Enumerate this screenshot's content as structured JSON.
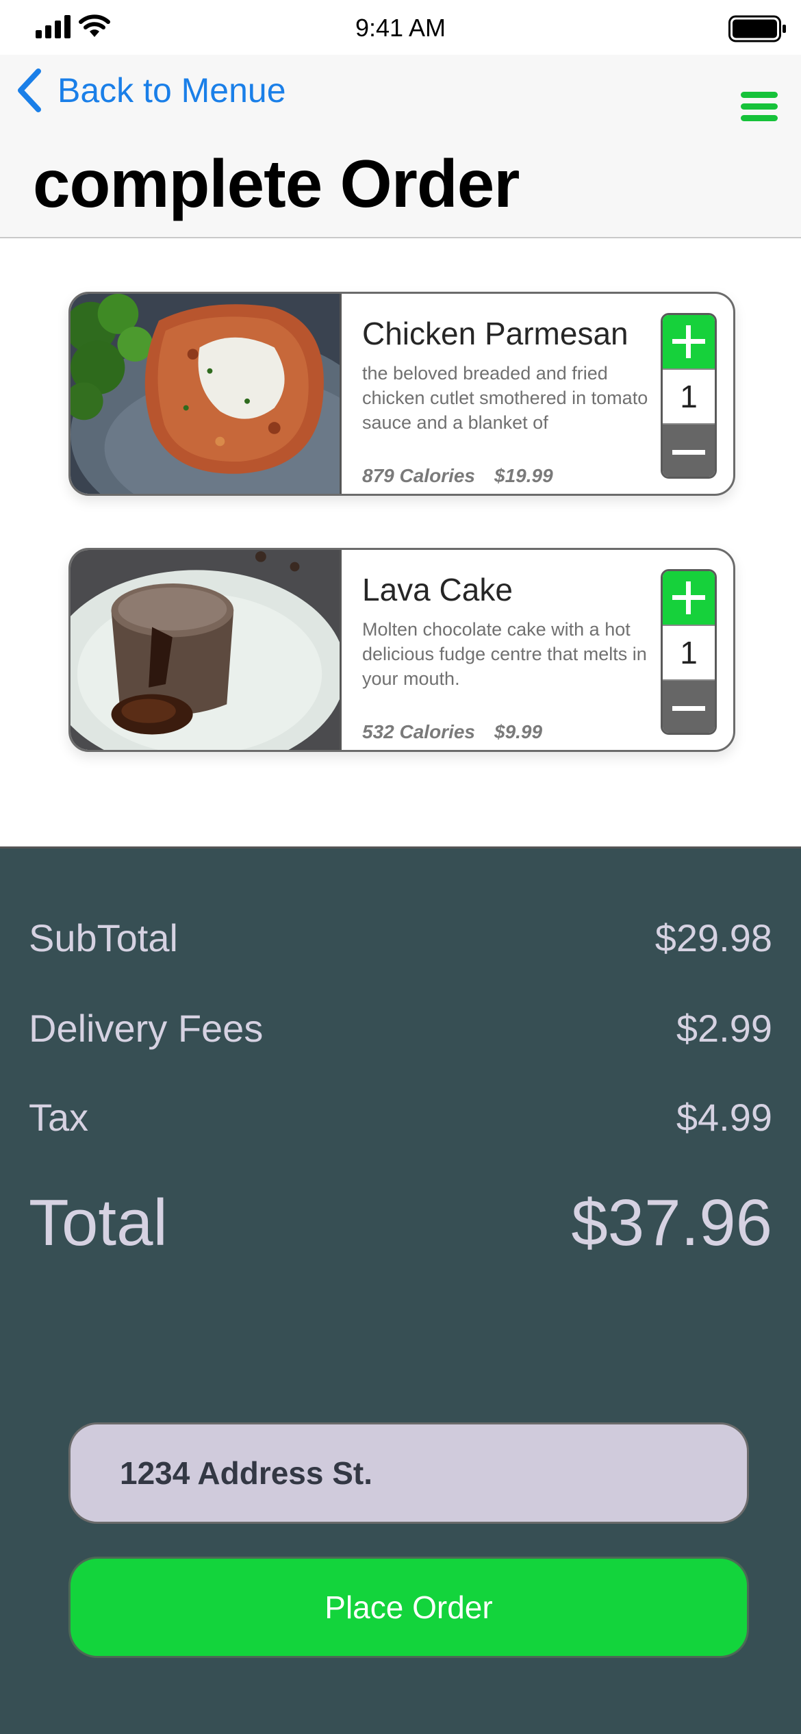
{
  "status_bar": {
    "time": "9:41 AM"
  },
  "nav": {
    "back_label": "Back to Menue",
    "title": "complete Order"
  },
  "items": [
    {
      "name": "Chicken Parmesan",
      "description": "the beloved breaded and fried chicken cutlet smothered in tomato sauce and a blanket of",
      "calories": "879 Calories",
      "price": "$19.99",
      "quantity": "1",
      "image": "chicken-parmesan-photo"
    },
    {
      "name": "Lava Cake",
      "description": "Molten chocolate cake with a hot delicious fudge centre that melts in your mouth.",
      "calories": "532 Calories",
      "price": "$9.99",
      "quantity": "1",
      "image": "lava-cake-photo"
    }
  ],
  "summary": {
    "subtotal_label": "SubTotal",
    "subtotal_value": "$29.98",
    "delivery_label": "Delivery Fees",
    "delivery_value": "$2.99",
    "tax_label": "Tax",
    "tax_value": "$4.99",
    "total_label": "Total",
    "total_value": "$37.96"
  },
  "address": {
    "value": "1234 Address St."
  },
  "actions": {
    "place_order_label": "Place Order"
  },
  "colors": {
    "accent_green": "#13d43c",
    "link_blue": "#1a7fe8",
    "panel_bg": "#374f54",
    "summary_text": "#d6d2e2"
  }
}
